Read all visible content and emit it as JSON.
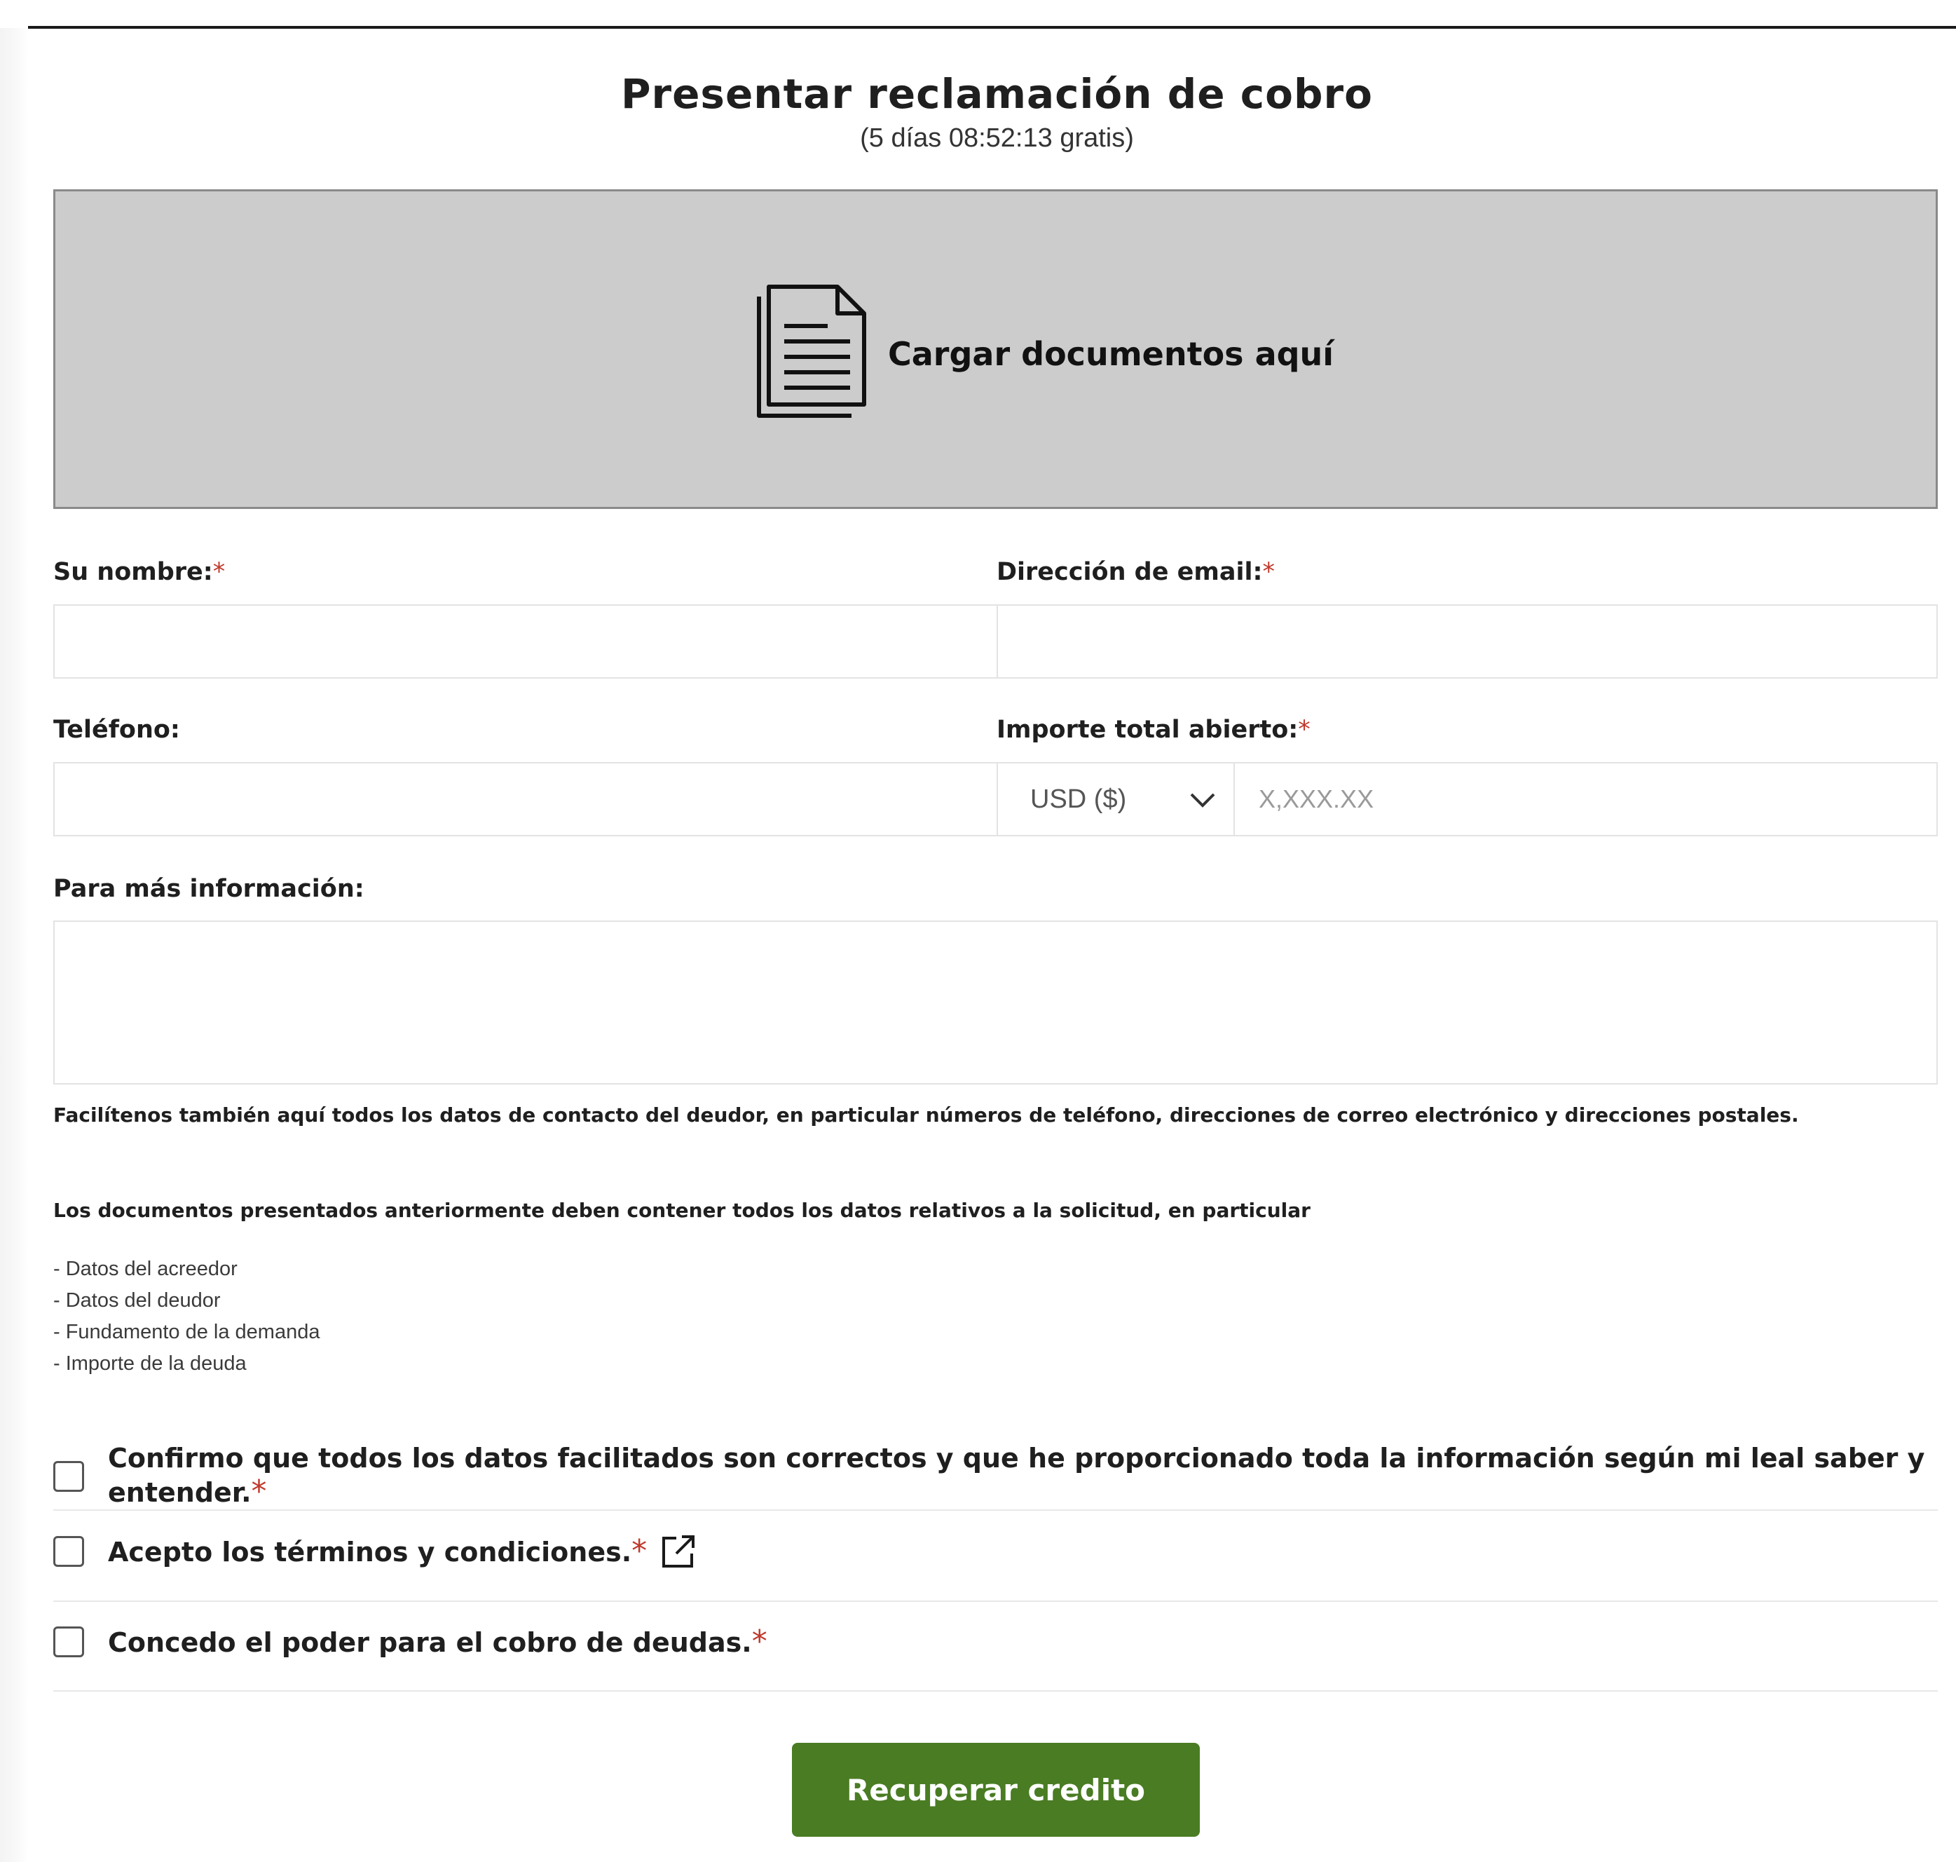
{
  "form": {
    "title": "Presentar reclamación de cobro",
    "subtitle": "(5 días 08:52:13 gratis)"
  },
  "upload": {
    "label": "Cargar documentos aquí",
    "icon": "document-icon"
  },
  "fields": {
    "name_label": "Su nombre:",
    "email_label": "Dirección de email:",
    "phone_label": "Teléfono:",
    "amount_label": "Importe total abierto:",
    "currency_value": "USD ($)",
    "amount_placeholder": "X,XXX.XX",
    "info_label": "Para más información:",
    "required_mark": "*"
  },
  "notes": {
    "contact_hint": "Facilítenos también aquí todos los datos de contacto del deudor, en particular números de teléfono, direcciones de correo electrónico y direcciones postales.",
    "documents_hint": "Los documentos presentados anteriormente deben contener todos los datos relativos a la solicitud, en particular",
    "items": [
      "- Datos del acreedor",
      "- Datos del deudor",
      "- Fundamento de la demanda",
      "- Importe de la deuda"
    ]
  },
  "checkboxes": {
    "confirm": "Confirmo que todos los datos facilitados son correctos y que he proporcionado toda la información según mi leal saber y entender.",
    "terms": "Acepto los términos y condiciones.",
    "power": "Concedo el poder para el cobro de deudas.",
    "confirm_checked": false,
    "terms_checked": false,
    "power_checked": false
  },
  "actions": {
    "submit_label": "Recuperar credito"
  },
  "colors": {
    "accent": "#4a7c23",
    "required": "#c0392b",
    "upload_bg": "#cccccc"
  }
}
